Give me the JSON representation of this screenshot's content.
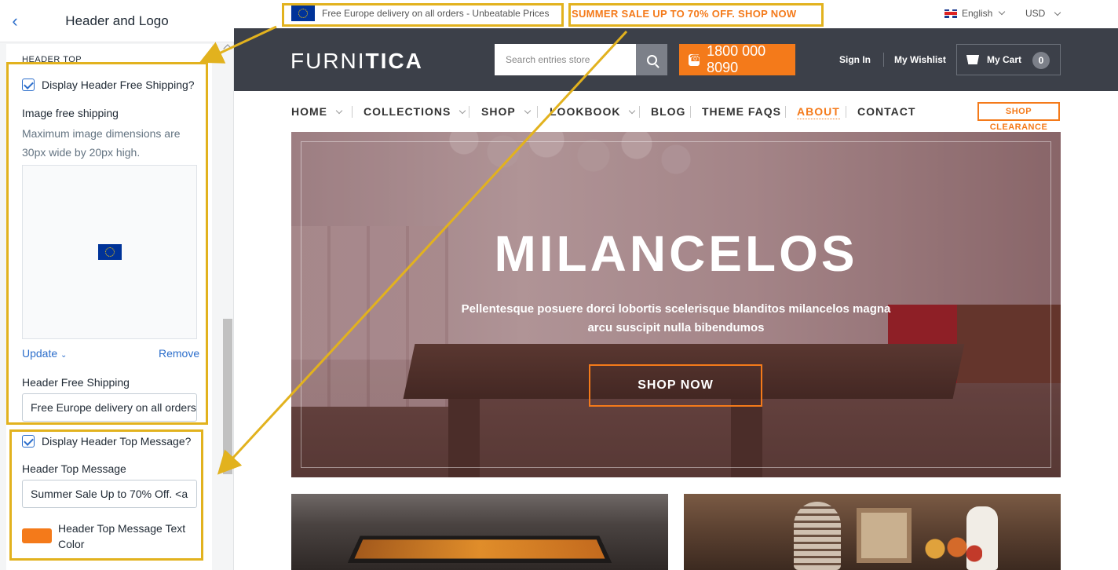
{
  "panel": {
    "title": "Header and Logo",
    "section_label": "HEADER TOP",
    "free_shipping_checkbox": "Display Header Free Shipping?",
    "image_label": "Image free shipping",
    "image_help": "Maximum image dimensions are 30px wide by 20px high.",
    "update_link": "Update",
    "remove_link": "Remove",
    "free_shipping_label": "Header Free Shipping",
    "free_shipping_value": "Free Europe delivery on all orders - Unbeatable Prices",
    "top_message_checkbox": "Display Header Top Message?",
    "top_message_label": "Header Top Message",
    "top_message_value": "Summer Sale Up to 70% Off. <a",
    "text_color_label": "Header Top Message Text Color",
    "text_color_value": "#f47a1a"
  },
  "topbar": {
    "free_shipping": "Free Europe delivery on all orders - Unbeatable Prices",
    "sale_message": "SUMMER SALE UP TO 70% OFF. SHOP NOW",
    "language": "English",
    "currency": "USD"
  },
  "header": {
    "logo_light": "FURNI",
    "logo_bold": "TICA",
    "search_placeholder": "Search entries store",
    "phone": "1800 000 8090",
    "sign_in": "Sign In",
    "wishlist": "My Wishlist",
    "cart_label": "My Cart",
    "cart_count": "0"
  },
  "nav": {
    "items": [
      "HOME",
      "COLLECTIONS",
      "SHOP",
      "LOOKBOOK",
      "BLOG",
      "THEME FAQS",
      "ABOUT",
      "CONTACT"
    ],
    "clearance": "SHOP CLEARANCE"
  },
  "hero": {
    "title": "MILANCELOS",
    "subtitle": "Pellentesque posuere dorci lobortis scelerisque blanditos milancelos magna arcu suscipit nulla bibendumos",
    "button": "SHOP NOW"
  },
  "colors": {
    "accent": "#f47a1a",
    "header_bg": "#3c4049",
    "annotation": "#e2b21e",
    "link": "#2c6ecb"
  }
}
